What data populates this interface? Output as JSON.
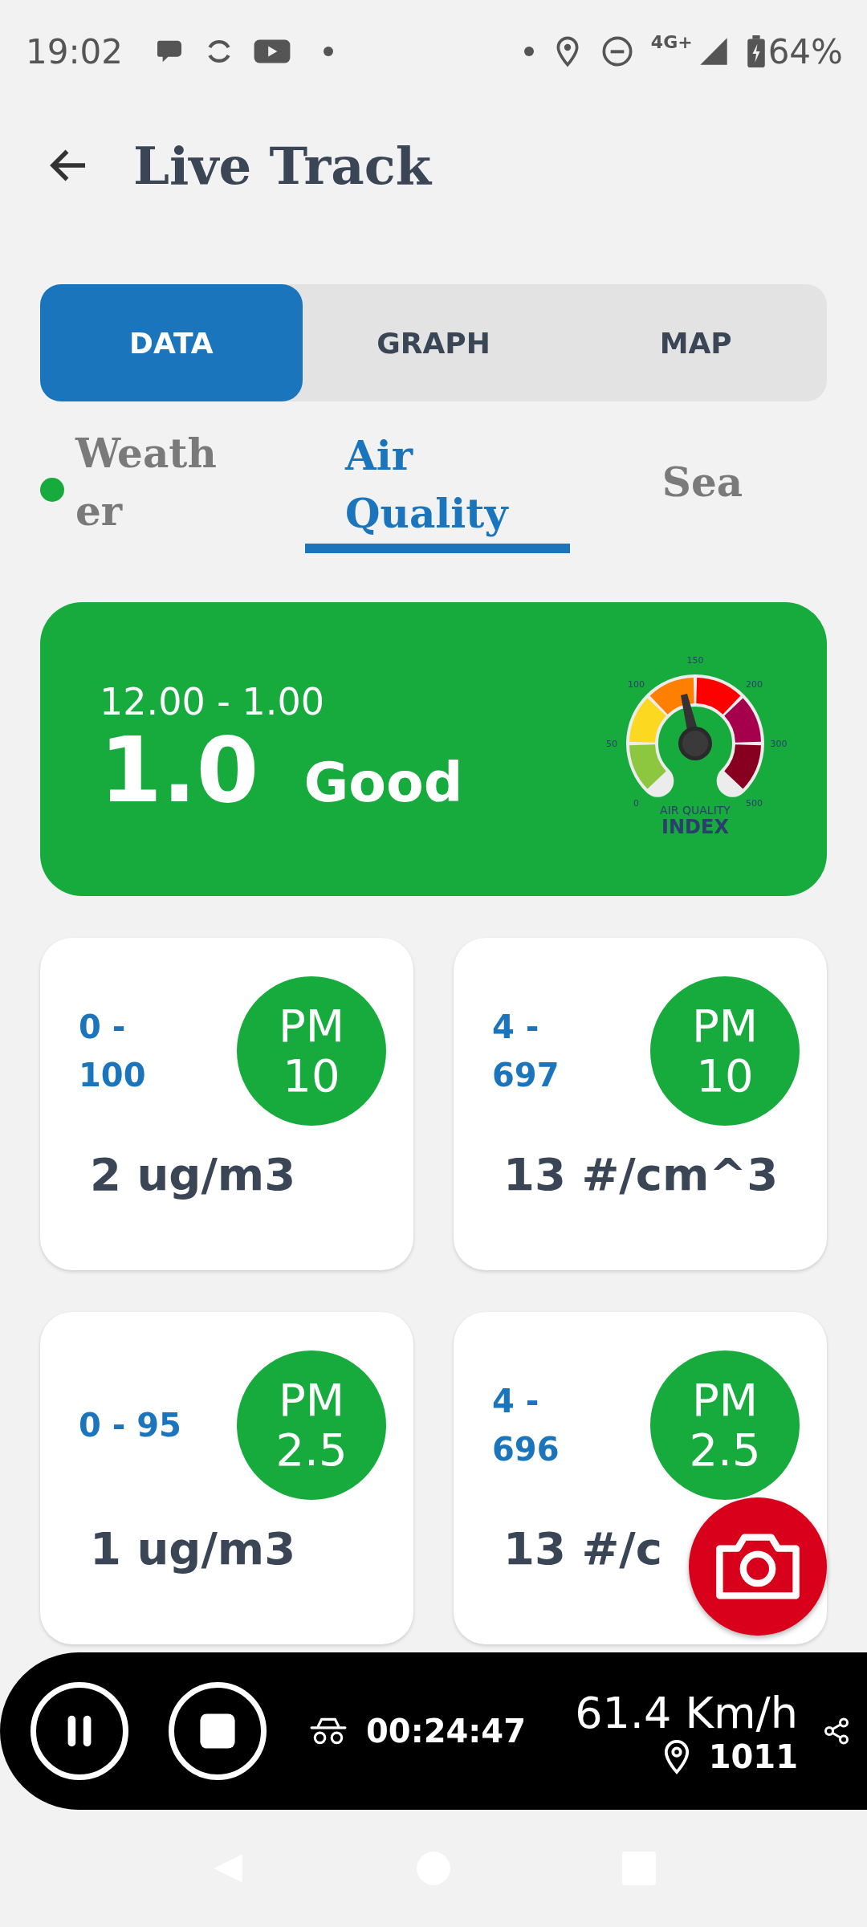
{
  "status_bar": {
    "time": "19:02",
    "network": "4G+",
    "battery": "64%"
  },
  "header": {
    "title": "Live Track"
  },
  "tabs": [
    {
      "label": "DATA",
      "selected": true
    },
    {
      "label": "GRAPH",
      "selected": false
    },
    {
      "label": "MAP",
      "selected": false
    }
  ],
  "sub_tabs": [
    {
      "label": "Weather",
      "selected": false,
      "color": "#17ab3e"
    },
    {
      "label": "Air Quality",
      "selected": true
    },
    {
      "label": "Sea",
      "selected": false
    }
  ],
  "aqi": {
    "range": "12.00 - 1.00",
    "value": "1.0",
    "rating": "Good",
    "gauge": {
      "ticks": [
        "0",
        "50",
        "100",
        "150",
        "200",
        "300",
        "500"
      ],
      "caption_top": "AIR QUALITY",
      "caption": "INDEX"
    }
  },
  "sensors": [
    {
      "range": "0 - 100",
      "label": "PM 10",
      "value": "2 ug/m3"
    },
    {
      "range": "4 - 697",
      "label": "PM 10",
      "value": "13 #/cm^3"
    },
    {
      "range": "0 - 95",
      "label": "PM 2.5",
      "value": "1 ug/m3"
    },
    {
      "range": "4 - 696",
      "label": "PM 2.5",
      "value": "13 #/c"
    }
  ],
  "tracker": {
    "elapsed": "00:24:47",
    "speed": "61.4 Km/h",
    "points": "1011"
  }
}
